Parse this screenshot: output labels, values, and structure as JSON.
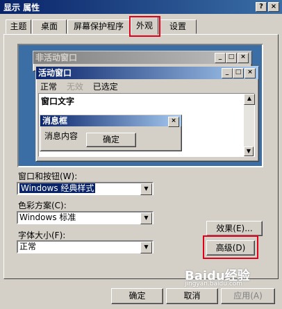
{
  "window": {
    "title": "显示 属性",
    "help_glyph": "?",
    "close_glyph": "×"
  },
  "tabs": [
    "主题",
    "桌面",
    "屏幕保护程序",
    "外观",
    "设置"
  ],
  "preview": {
    "inactive_title": "非活动窗口",
    "active_title": "活动窗口",
    "menu": {
      "normal": "正常",
      "disabled": "无效",
      "selected": "已选定"
    },
    "window_text": "窗口文字",
    "msgbox_title": "消息框",
    "msgbox_content": "消息内容",
    "msgbox_ok": "确定",
    "glyph_min": "_",
    "glyph_max": "□",
    "glyph_close": "×",
    "glyph_up": "▲",
    "glyph_down": "▼"
  },
  "form": {
    "window_buttons_label": "窗口和按钮(W):",
    "window_buttons_value": "Windows 经典样式",
    "color_scheme_label": "色彩方案(C):",
    "color_scheme_value": "Windows 标准",
    "font_size_label": "字体大小(F):",
    "font_size_value": "正常",
    "effects_button": "效果(E)...",
    "advanced_button": "高级(D)",
    "select_arrow": "▼"
  },
  "footer": {
    "ok": "确定",
    "cancel": "取消",
    "apply": "应用(A)"
  },
  "watermark": {
    "logo": "Baidu经验",
    "url": "jingyan.baidu.com"
  },
  "colors": {
    "titlebar": "#0a246a",
    "desktop": "#3a6ea5",
    "face": "#d4d0c8",
    "highlight_box": "#e0001a"
  }
}
